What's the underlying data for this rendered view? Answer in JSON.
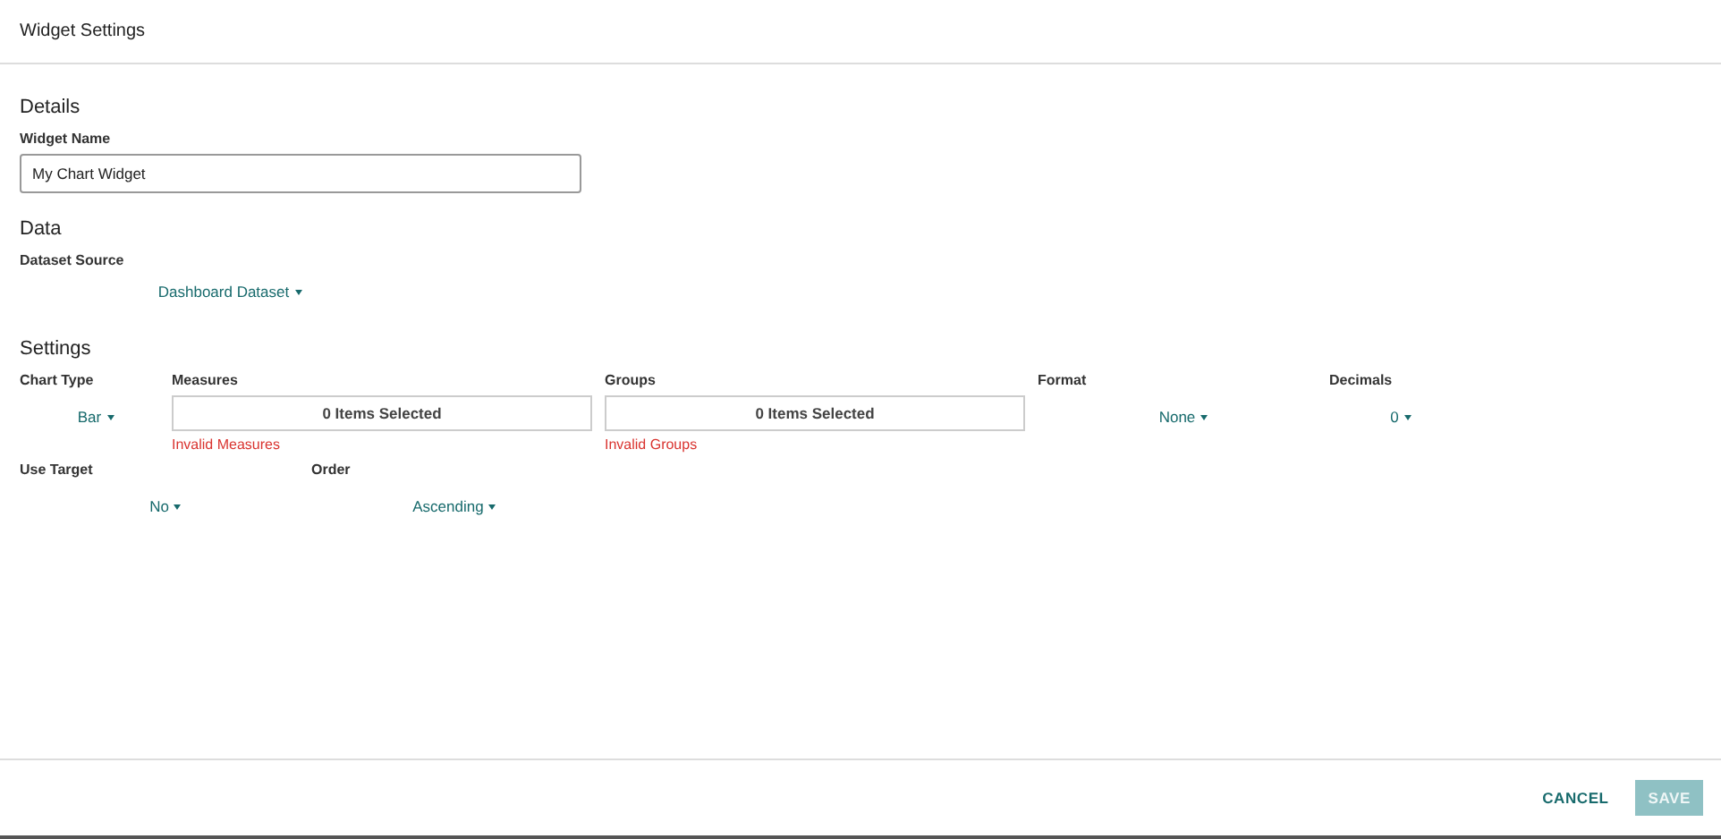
{
  "window": {
    "title": "Widget Settings"
  },
  "details": {
    "heading": "Details",
    "widget_name": {
      "label": "Widget Name",
      "value": "My Chart Widget"
    }
  },
  "data": {
    "heading": "Data",
    "dataset_source": {
      "label": "Dataset Source",
      "value": "Dashboard Dataset"
    }
  },
  "settings": {
    "heading": "Settings",
    "rows": [
      [
        {
          "kind": "dropdown",
          "label": "Chart Type",
          "value": "Bar"
        },
        {
          "kind": "multiselect",
          "label": "Measures",
          "value": "0 Items Selected",
          "error": "Invalid Measures"
        },
        {
          "kind": "multiselect",
          "label": "Groups",
          "value": "0 Items Selected",
          "error": "Invalid Groups"
        },
        {
          "kind": "dropdown",
          "label": "Format",
          "value": "None"
        },
        {
          "kind": "dropdown",
          "label": "Decimals",
          "value": "0"
        }
      ],
      [
        {
          "kind": "dropdown",
          "label": "Use Target",
          "value": "No"
        },
        {
          "kind": "dropdown",
          "label": "Order",
          "value": "Ascending"
        }
      ]
    ]
  },
  "footer": {
    "buttons": [
      {
        "label": "CANCEL",
        "kind": "text",
        "disabled": false
      },
      {
        "label": "SAVE",
        "kind": "filled",
        "disabled": true
      }
    ]
  }
}
